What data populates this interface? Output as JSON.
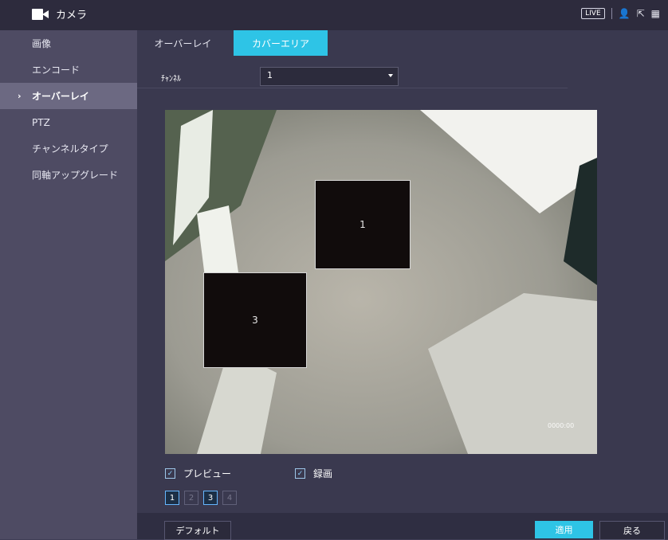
{
  "header": {
    "title": "カメラ",
    "live_label": "LIVE"
  },
  "sidebar": {
    "items": [
      {
        "label": "画像"
      },
      {
        "label": "エンコード"
      },
      {
        "label": "オーバーレイ"
      },
      {
        "label": "PTZ"
      },
      {
        "label": "チャンネルタイプ"
      },
      {
        "label": "同軸アップグレード"
      }
    ]
  },
  "tabs": [
    {
      "label": "オーバーレイ"
    },
    {
      "label": "カバーエリア"
    }
  ],
  "channel": {
    "label": "ﾁｬﾝﾈﾙ",
    "value": "1"
  },
  "overlays": [
    {
      "label": "1"
    },
    {
      "label": "3"
    }
  ],
  "timestamp": "0000:00",
  "checkboxes": {
    "preview": "プレビュー",
    "record": "録画"
  },
  "regions": [
    "1",
    "2",
    "3",
    "4"
  ],
  "buttons": {
    "default": "デフォルト",
    "apply": "適用",
    "back": "戻る"
  },
  "colors": {
    "accent": "#2ec4e6",
    "sidebar": "#4e4b63",
    "topbar": "#2d2b3d"
  }
}
